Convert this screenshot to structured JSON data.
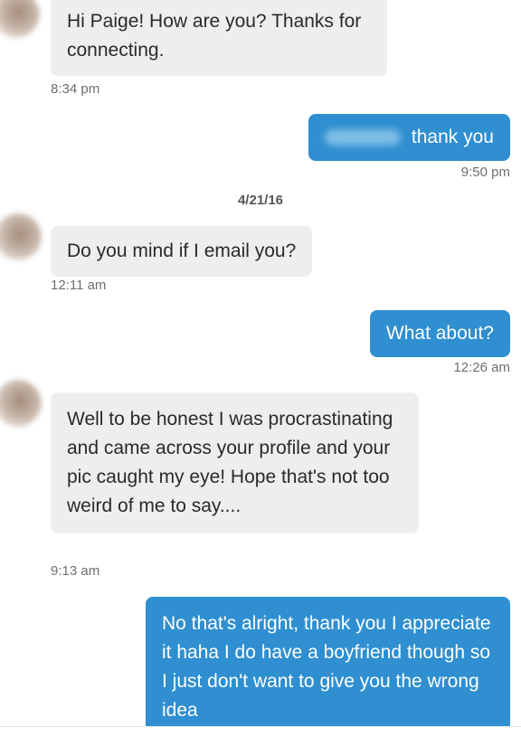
{
  "messages": [
    {
      "text": "Hi Paige! How are you? Thanks for connecting.",
      "time": "8:34 pm"
    },
    {
      "text": "thank you",
      "time": "9:50 pm"
    },
    {
      "date": "4/21/16"
    },
    {
      "text": "Do you mind if I email you?",
      "time": "12:11 am"
    },
    {
      "text": "What about?",
      "time": "12:26 am"
    },
    {
      "text": "Well to be honest I was procrastinating and came across your profile and your pic caught my eye! Hope that's not too weird of me to say....",
      "time": "9:13 am"
    },
    {
      "text": "No that's alright, thank you I appreciate it haha I do have a boyfriend though so I just don't want to give you the wrong idea"
    }
  ],
  "colors": {
    "incoming_bubble": "#edeef0",
    "outgoing_bubble": "#2f8fd0",
    "timestamp": "#6f6f6f"
  },
  "icons": {
    "avatar": "contact-avatar-blurred",
    "name_redaction": "blurred-name"
  }
}
